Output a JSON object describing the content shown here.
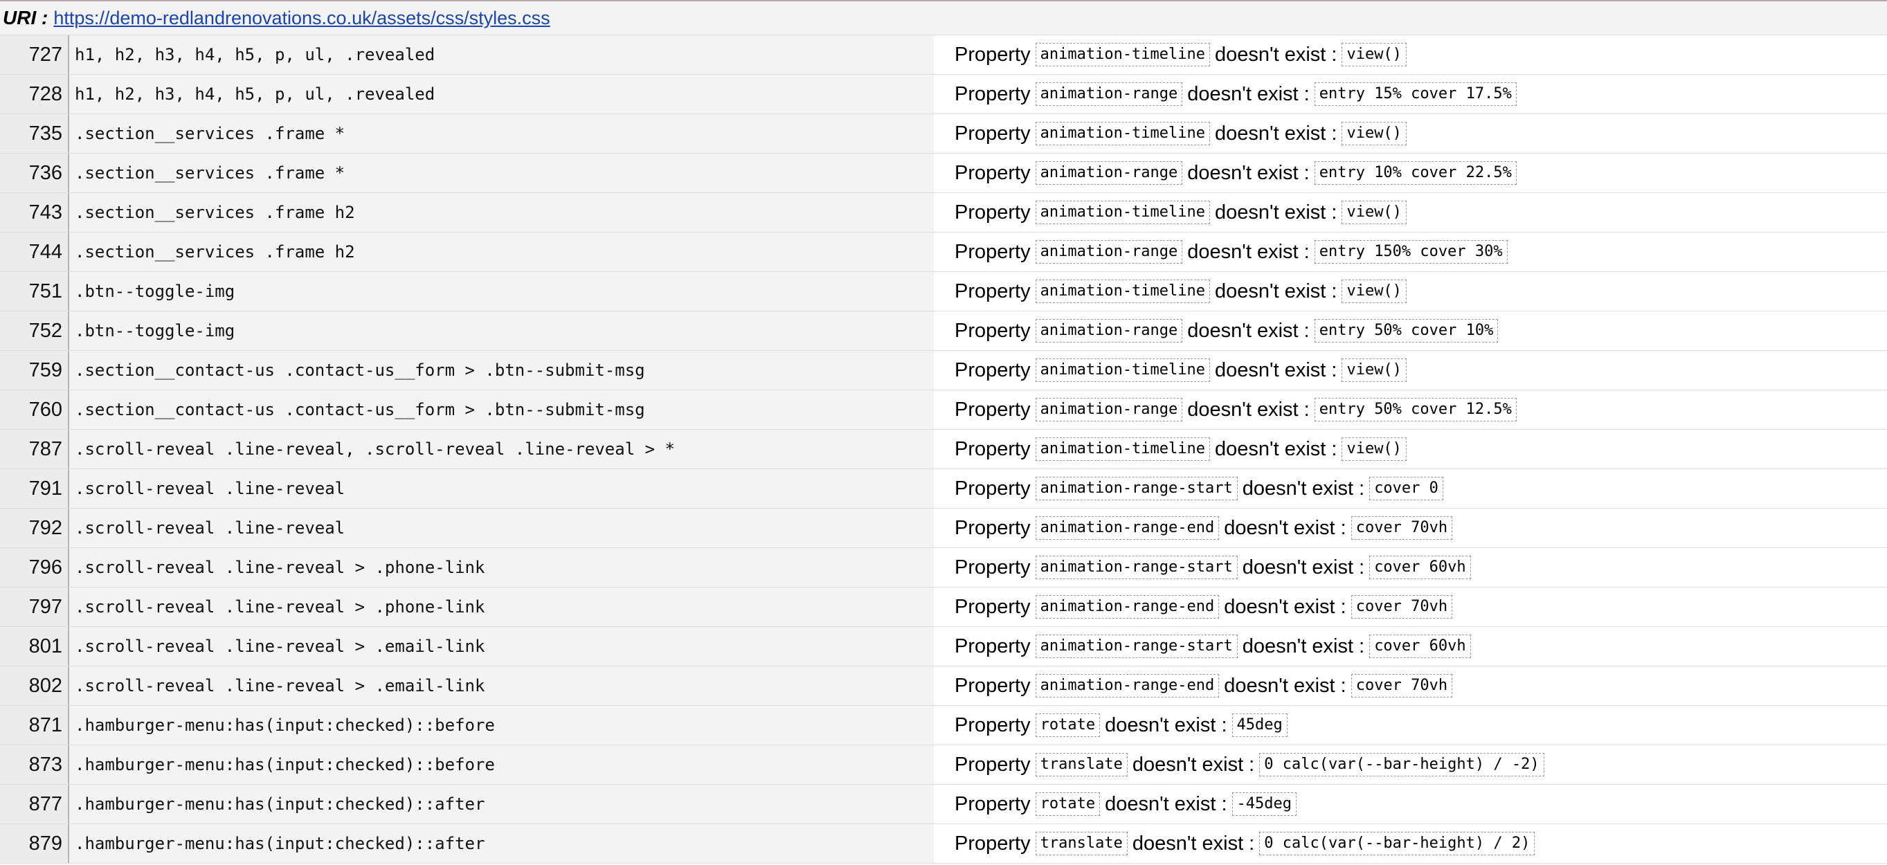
{
  "header": {
    "uri_label": "URI :",
    "uri": "https://demo-redlandrenovations.co.uk/assets/css/styles.css"
  },
  "labels": {
    "property": "Property",
    "doesnt_exist": "doesn't exist :"
  },
  "rows": [
    {
      "line": "727",
      "selector": "h1, h2, h3, h4, h5, p, ul, .revealed",
      "property": "animation-timeline",
      "value": "view()"
    },
    {
      "line": "728",
      "selector": "h1, h2, h3, h4, h5, p, ul, .revealed",
      "property": "animation-range",
      "value": "entry 15% cover 17.5%"
    },
    {
      "line": "735",
      "selector": ".section__services .frame *",
      "property": "animation-timeline",
      "value": "view()"
    },
    {
      "line": "736",
      "selector": ".section__services .frame *",
      "property": "animation-range",
      "value": "entry 10% cover 22.5%"
    },
    {
      "line": "743",
      "selector": ".section__services .frame h2",
      "property": "animation-timeline",
      "value": "view()"
    },
    {
      "line": "744",
      "selector": ".section__services .frame h2",
      "property": "animation-range",
      "value": "entry 150% cover 30%"
    },
    {
      "line": "751",
      "selector": ".btn--toggle-img",
      "property": "animation-timeline",
      "value": "view()"
    },
    {
      "line": "752",
      "selector": ".btn--toggle-img",
      "property": "animation-range",
      "value": "entry 50% cover 10%"
    },
    {
      "line": "759",
      "selector": ".section__contact-us .contact-us__form > .btn--submit-msg",
      "property": "animation-timeline",
      "value": "view()"
    },
    {
      "line": "760",
      "selector": ".section__contact-us .contact-us__form > .btn--submit-msg",
      "property": "animation-range",
      "value": "entry 50% cover 12.5%"
    },
    {
      "line": "787",
      "selector": ".scroll-reveal .line-reveal, .scroll-reveal .line-reveal > *",
      "property": "animation-timeline",
      "value": "view()"
    },
    {
      "line": "791",
      "selector": ".scroll-reveal .line-reveal",
      "property": "animation-range-start",
      "value": "cover 0"
    },
    {
      "line": "792",
      "selector": ".scroll-reveal .line-reveal",
      "property": "animation-range-end",
      "value": "cover 70vh"
    },
    {
      "line": "796",
      "selector": ".scroll-reveal .line-reveal > .phone-link",
      "property": "animation-range-start",
      "value": "cover 60vh"
    },
    {
      "line": "797",
      "selector": ".scroll-reveal .line-reveal > .phone-link",
      "property": "animation-range-end",
      "value": "cover 70vh"
    },
    {
      "line": "801",
      "selector": ".scroll-reveal .line-reveal > .email-link",
      "property": "animation-range-start",
      "value": "cover 60vh"
    },
    {
      "line": "802",
      "selector": ".scroll-reveal .line-reveal > .email-link",
      "property": "animation-range-end",
      "value": "cover 70vh"
    },
    {
      "line": "871",
      "selector": ".hamburger-menu:has(input:checked)::before",
      "property": "rotate",
      "value": "45deg"
    },
    {
      "line": "873",
      "selector": ".hamburger-menu:has(input:checked)::before",
      "property": "translate",
      "value": "0 calc(var(--bar-height) / -2)"
    },
    {
      "line": "877",
      "selector": ".hamburger-menu:has(input:checked)::after",
      "property": "rotate",
      "value": "-45deg"
    },
    {
      "line": "879",
      "selector": ".hamburger-menu:has(input:checked)::after",
      "property": "translate",
      "value": "0 calc(var(--bar-height) / 2)"
    }
  ]
}
